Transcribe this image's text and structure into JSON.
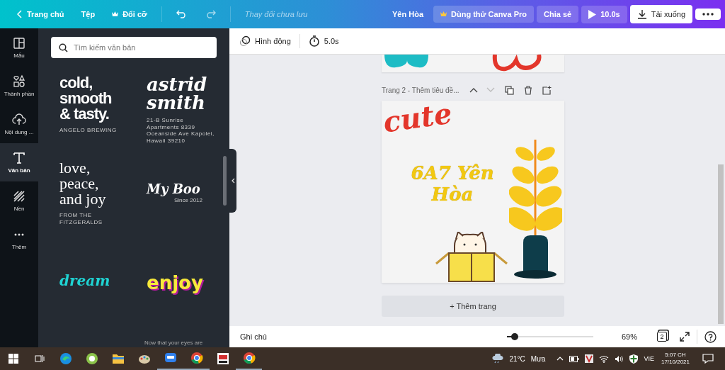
{
  "topbar": {
    "home": "Trang chủ",
    "file": "Tệp",
    "resize": "Đổi cỡ",
    "status": "Thay đổi chưa lưu",
    "design_name": "Yên Hòa",
    "pro": "Dùng thử Canva Pro",
    "share": "Chia sẻ",
    "play": "10.0s",
    "download": "Tải xuống"
  },
  "rail": [
    {
      "label": "Mẫu",
      "selected": false
    },
    {
      "label": "Thành phần",
      "selected": false
    },
    {
      "label": "Nội dung ...",
      "selected": false
    },
    {
      "label": "Văn bản",
      "selected": true
    },
    {
      "label": "Nền",
      "selected": false
    },
    {
      "label": "Thêm",
      "selected": false
    }
  ],
  "panel": {
    "search_placeholder": "Tìm kiếm văn bản",
    "templates": [
      {
        "kind": "sans",
        "lines": [
          "cold,",
          "smooth",
          "& tasty."
        ],
        "caption": "ANGELO BREWING"
      },
      {
        "kind": "italic",
        "lines": [
          "astrid",
          "smith"
        ],
        "caption": "21-B Sunrise Apartments 8339 Oceanside Ave Kapolei, Hawaii 39210"
      },
      {
        "kind": "serif",
        "lines": [
          "love,",
          "peace,",
          "and joy"
        ],
        "caption": "FROM THE FITZGERALDS"
      },
      {
        "kind": "display",
        "lines": [
          "My Boo"
        ],
        "caption": "Since 2012"
      },
      {
        "kind": "script",
        "lines": [
          "dream"
        ]
      },
      {
        "kind": "pop",
        "lines": [
          "enjoy"
        ]
      }
    ],
    "footer_text": "Now that your eyes are"
  },
  "toolbar": {
    "animate": "Hình động",
    "duration": "5.0s"
  },
  "page": {
    "title": "Trang 2 - Thêm tiêu đề...",
    "sticker": "cute",
    "heading": "6A7 Yên Hòa",
    "add_page": "+ Thêm trang"
  },
  "bottom": {
    "notes": "Ghi chú",
    "zoom": {
      "level": 0.09
    },
    "zoom_text": "69%",
    "page_count": "2"
  },
  "taskbar": {
    "temperature": "21°C",
    "weather": "Mưa",
    "language": "VIE",
    "time": "5:07 CH",
    "date": "17/10/2021"
  }
}
